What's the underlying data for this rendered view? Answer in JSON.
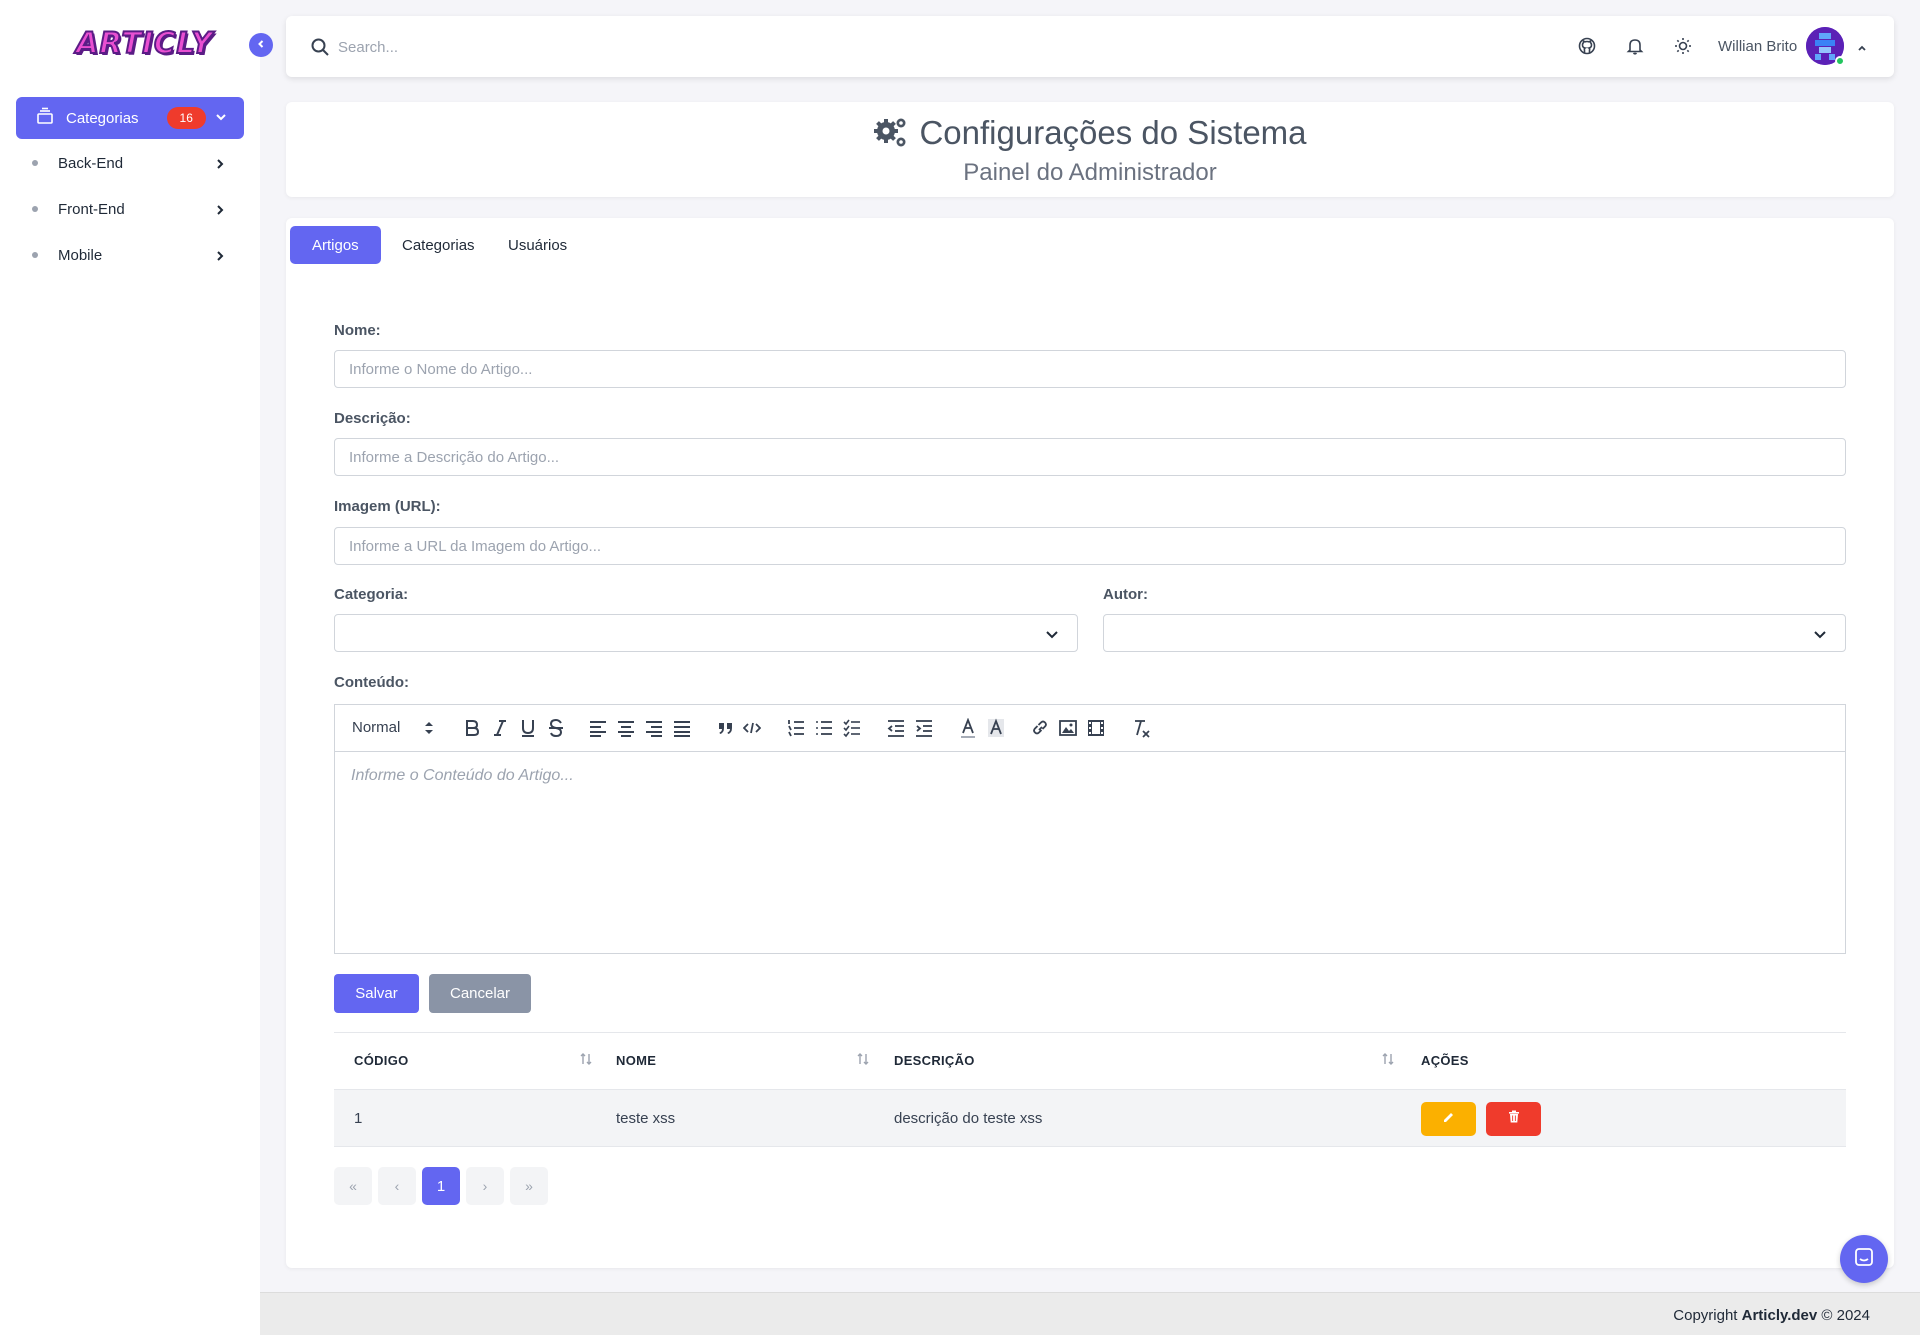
{
  "app": {
    "logo_text": "ARTICLY"
  },
  "sidebar": {
    "active_item": {
      "label": "Categorias",
      "badge": "16"
    },
    "items": [
      {
        "label": "Back-End"
      },
      {
        "label": "Front-End"
      },
      {
        "label": "Mobile"
      }
    ]
  },
  "topbar": {
    "search_placeholder": "Search...",
    "user_name": "Willian Brito",
    "icons": [
      "github-icon",
      "bell-icon",
      "sun-icon"
    ]
  },
  "header": {
    "title": "Configurações do Sistema",
    "subtitle": "Painel do Administrador"
  },
  "tabs": [
    {
      "label": "Artigos",
      "active": true
    },
    {
      "label": "Categorias",
      "active": false
    },
    {
      "label": "Usuários",
      "active": false
    }
  ],
  "form": {
    "name_label": "Nome:",
    "name_placeholder": "Informe o Nome do Artigo...",
    "desc_label": "Descrição:",
    "desc_placeholder": "Informe a Descrição do Artigo...",
    "image_label": "Imagem (URL):",
    "image_placeholder": "Informe a URL da Imagem do Artigo...",
    "category_label": "Categoria:",
    "author_label": "Autor:",
    "content_label": "Conteúdo:",
    "editor_format": "Normal",
    "editor_placeholder": "Informe o Conteúdo do Artigo...",
    "save_label": "Salvar",
    "cancel_label": "Cancelar"
  },
  "table": {
    "columns": [
      "CÓDIGO",
      "NOME",
      "DESCRIÇÃO",
      "AÇÕES"
    ],
    "rows": [
      {
        "code": "1",
        "name": "teste xss",
        "description": "descrição do teste xss"
      }
    ]
  },
  "pagination": {
    "first": "«",
    "prev": "‹",
    "current": "1",
    "next": "›",
    "last": "»"
  },
  "footer": {
    "prefix": "Copyright",
    "brand": "Articly.dev",
    "suffix": "© 2024"
  },
  "colors": {
    "primary": "#6366f1",
    "edit": "#fbb000",
    "delete": "#ef3b2c",
    "cancel": "#8a94a6"
  }
}
